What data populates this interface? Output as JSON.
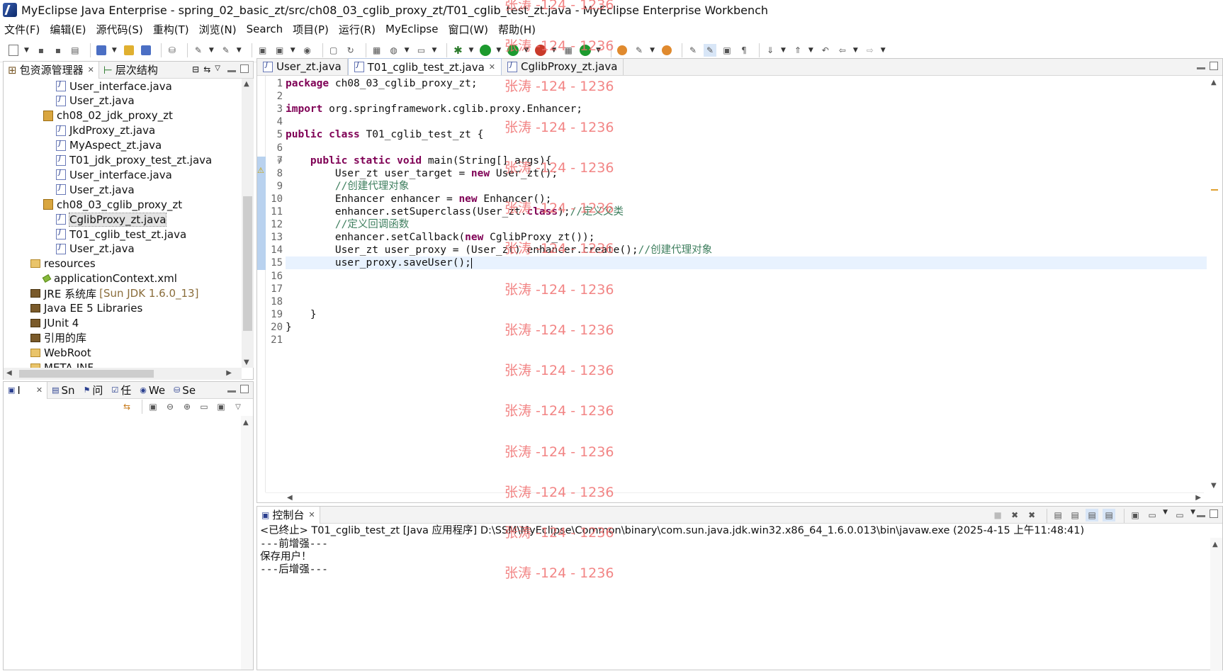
{
  "window": {
    "title": "MyEclipse Java Enterprise  -  spring_02_basic_zt/src/ch08_03_cglib_proxy_zt/T01_cglib_test_zt.java  -  MyEclipse Enterprise Workbench"
  },
  "menu": [
    "文件(F)",
    "编辑(E)",
    "源代码(S)",
    "重构(T)",
    "浏览(N)",
    "Search",
    "项目(P)",
    "运行(R)",
    "MyEclipse",
    "窗口(W)",
    "帮助(H)"
  ],
  "explorer": {
    "tabs": [
      {
        "label": "包资源管理器"
      },
      {
        "label": "层次结构"
      }
    ],
    "items": [
      {
        "label": "User_interface.java",
        "type": "java"
      },
      {
        "label": "User_zt.java",
        "type": "java"
      },
      {
        "label": "ch08_02_jdk_proxy_zt",
        "type": "package"
      },
      {
        "label": "JkdProxy_zt.java",
        "type": "java"
      },
      {
        "label": "MyAspect_zt.java",
        "type": "java"
      },
      {
        "label": "T01_jdk_proxy_test_zt.java",
        "type": "java"
      },
      {
        "label": "User_interface.java",
        "type": "java"
      },
      {
        "label": "User_zt.java",
        "type": "java"
      },
      {
        "label": "ch08_03_cglib_proxy_zt",
        "type": "package"
      },
      {
        "label": "CglibProxy_zt.java",
        "type": "java"
      },
      {
        "label": "T01_cglib_test_zt.java",
        "type": "java"
      },
      {
        "label": "User_zt.java",
        "type": "java"
      },
      {
        "label": "resources",
        "type": "folder"
      },
      {
        "label": "applicationContext.xml",
        "type": "xml"
      },
      {
        "label": "JRE 系统库",
        "type": "library",
        "suffix": "[Sun JDK 1.6.0_13]"
      },
      {
        "label": "Java EE 5 Libraries",
        "type": "library"
      },
      {
        "label": "JUnit 4",
        "type": "library"
      },
      {
        "label": "引用的库",
        "type": "library"
      },
      {
        "label": "WebRoot",
        "type": "folder"
      },
      {
        "label": "META-INF",
        "type": "folder"
      }
    ]
  },
  "bottom_left": {
    "tabs": [
      {
        "label": "I"
      },
      {
        "label": "Sn"
      },
      {
        "label": "问"
      },
      {
        "label": "任"
      },
      {
        "label": "We"
      },
      {
        "label": "Se"
      }
    ]
  },
  "editor": {
    "tabs": [
      {
        "label": "User_zt.java"
      },
      {
        "label": "T01_cglib_test_zt.java"
      },
      {
        "label": "CglibProxy_zt.java"
      }
    ],
    "line_numbers": [
      "1",
      "2",
      "3",
      "4",
      "5",
      "6",
      "7",
      "8",
      "9",
      "10",
      "11",
      "12",
      "13",
      "14",
      "15",
      "16",
      "17",
      "18",
      "19",
      "20",
      "21"
    ],
    "lines": [
      {
        "indent": "",
        "parts": [
          {
            "t": "package",
            "k": "kw"
          },
          {
            "t": " ch08_03_cglib_proxy_zt;"
          }
        ]
      },
      {
        "indent": "",
        "parts": []
      },
      {
        "indent": "",
        "parts": [
          {
            "t": "import",
            "k": "kw"
          },
          {
            "t": " org.springframework.cglib.proxy.Enhancer;"
          }
        ]
      },
      {
        "indent": "",
        "parts": []
      },
      {
        "indent": "",
        "parts": [
          {
            "t": "public",
            "k": "kw"
          },
          {
            "t": " "
          },
          {
            "t": "class",
            "k": "kw"
          },
          {
            "t": " T01_cglib_test_zt {"
          }
        ]
      },
      {
        "indent": "",
        "parts": []
      },
      {
        "indent": "    ",
        "parts": [
          {
            "t": "public",
            "k": "kw"
          },
          {
            "t": " "
          },
          {
            "t": "static",
            "k": "kw"
          },
          {
            "t": " "
          },
          {
            "t": "void",
            "k": "kw"
          },
          {
            "t": " main(String[] args){"
          }
        ]
      },
      {
        "indent": "        ",
        "parts": [
          {
            "t": "User_zt user_target = "
          },
          {
            "t": "new",
            "k": "kw"
          },
          {
            "t": " User_zt();"
          }
        ]
      },
      {
        "indent": "        ",
        "parts": [
          {
            "t": "//创建代理对象",
            "k": "cm"
          }
        ]
      },
      {
        "indent": "        ",
        "parts": [
          {
            "t": "Enhancer enhancer = "
          },
          {
            "t": "new",
            "k": "kw"
          },
          {
            "t": " Enhancer();"
          }
        ]
      },
      {
        "indent": "        ",
        "parts": [
          {
            "t": "enhancer.setSuperclass(User_zt."
          },
          {
            "t": "class",
            "k": "kw"
          },
          {
            "t": ");"
          },
          {
            "t": "//定义父类",
            "k": "cm"
          }
        ]
      },
      {
        "indent": "        ",
        "parts": [
          {
            "t": "//定义回调函数",
            "k": "cm"
          }
        ]
      },
      {
        "indent": "        ",
        "parts": [
          {
            "t": "enhancer.setCallback("
          },
          {
            "t": "new",
            "k": "kw"
          },
          {
            "t": " CglibProxy_zt());"
          }
        ]
      },
      {
        "indent": "        ",
        "parts": [
          {
            "t": "User_zt user_proxy = (User_zt) enhancer.create();"
          },
          {
            "t": "//创建代理对象",
            "k": "cm"
          }
        ]
      },
      {
        "indent": "        ",
        "parts": [
          {
            "t": "user_proxy.saveUser();"
          }
        ]
      },
      {
        "indent": "",
        "parts": []
      },
      {
        "indent": "",
        "parts": []
      },
      {
        "indent": "",
        "parts": []
      },
      {
        "indent": "    ",
        "parts": [
          {
            "t": "}"
          }
        ]
      },
      {
        "indent": "",
        "parts": [
          {
            "t": "}"
          }
        ]
      },
      {
        "indent": "",
        "parts": []
      }
    ]
  },
  "console": {
    "tab_label": "控制台",
    "description": "<已终止> T01_cglib_test_zt [Java 应用程序] D:\\SSM\\MyEclipse\\Common\\binary\\com.sun.java.jdk.win32.x86_64_1.6.0.013\\bin\\javaw.exe  (2025-4-15 上午11:48:41)",
    "output": [
      "---前增强---",
      "保存用户！",
      "---后增强---"
    ]
  },
  "watermark": {
    "text": "张涛 -124 - 1236"
  },
  "colors": {
    "keyword": "#7f0055",
    "comment": "#3f7f5f",
    "watermark": "#f07070",
    "current_line": "#e8f2fe"
  }
}
